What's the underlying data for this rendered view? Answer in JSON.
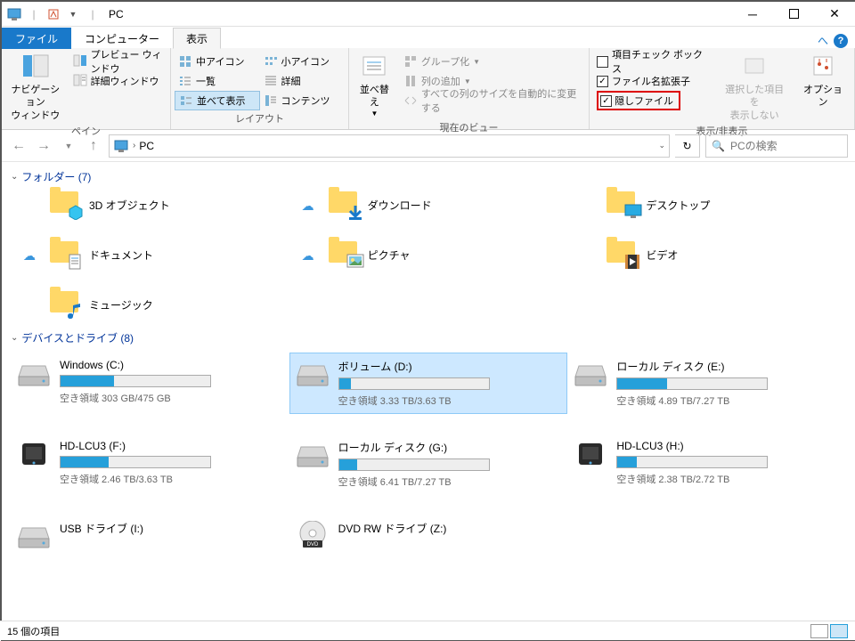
{
  "title": "PC",
  "tabs": {
    "file": "ファイル",
    "computer": "コンピューター",
    "view": "表示"
  },
  "ribbon": {
    "pane": {
      "nav": "ナビゲーション\nウィンドウ",
      "preview": "プレビュー ウィンドウ",
      "details": "詳細ウィンドウ",
      "label": "ペイン"
    },
    "layout": {
      "medium": "中アイコン",
      "small": "小アイコン",
      "list": "一覧",
      "details": "詳細",
      "tiles": "並べて表示",
      "content": "コンテンツ",
      "label": "レイアウト"
    },
    "view": {
      "sort": "並べ替え",
      "group": "グループ化",
      "addcol": "列の追加",
      "fitcols": "すべての列のサイズを自動的に変更する",
      "label": "現在のビュー"
    },
    "show": {
      "checkboxes": "項目チェック ボックス",
      "ext": "ファイル名拡張子",
      "hidden": "隠しファイル",
      "hidesel": "選択した項目を\n表示しない",
      "options": "オプション",
      "label": "表示/非表示"
    }
  },
  "nav": {
    "location": "PC",
    "search_ph": "PCの検索"
  },
  "sections": {
    "folders": "フォルダー (7)",
    "drives": "デバイスとドライブ (8)"
  },
  "folders": [
    {
      "name": "3D オブジェクト",
      "type": "3d",
      "cloud": false
    },
    {
      "name": "ダウンロード",
      "type": "download",
      "cloud": true
    },
    {
      "name": "デスクトップ",
      "type": "desktop",
      "cloud": false
    },
    {
      "name": "ドキュメント",
      "type": "document",
      "cloud": true
    },
    {
      "name": "ピクチャ",
      "type": "picture",
      "cloud": true
    },
    {
      "name": "ビデオ",
      "type": "video",
      "cloud": false
    },
    {
      "name": "ミュージック",
      "type": "music",
      "cloud": false
    }
  ],
  "drives": [
    {
      "name": "Windows (C:)",
      "stat": "空き領域 303 GB/475 GB",
      "fill": 36,
      "type": "hdd",
      "sel": false
    },
    {
      "name": "ボリューム (D:)",
      "stat": "空き領域 3.33 TB/3.63 TB",
      "fill": 8,
      "type": "hdd",
      "sel": true
    },
    {
      "name": "ローカル ディスク (E:)",
      "stat": "空き領域 4.89 TB/7.27 TB",
      "fill": 33,
      "type": "hdd",
      "sel": false
    },
    {
      "name": "HD-LCU3 (F:)",
      "stat": "空き領域 2.46 TB/3.63 TB",
      "fill": 32,
      "type": "ext",
      "sel": false
    },
    {
      "name": "ローカル ディスク (G:)",
      "stat": "空き領域 6.41 TB/7.27 TB",
      "fill": 12,
      "type": "hdd",
      "sel": false
    },
    {
      "name": "HD-LCU3 (H:)",
      "stat": "空き領域 2.38 TB/2.72 TB",
      "fill": 13,
      "type": "ext",
      "sel": false
    },
    {
      "name": "USB ドライブ (I:)",
      "stat": "",
      "fill": -1,
      "type": "hdd",
      "sel": false
    },
    {
      "name": "DVD RW ドライブ (Z:)",
      "stat": "",
      "fill": -1,
      "type": "dvd",
      "sel": false
    }
  ],
  "status": "15 個の項目"
}
